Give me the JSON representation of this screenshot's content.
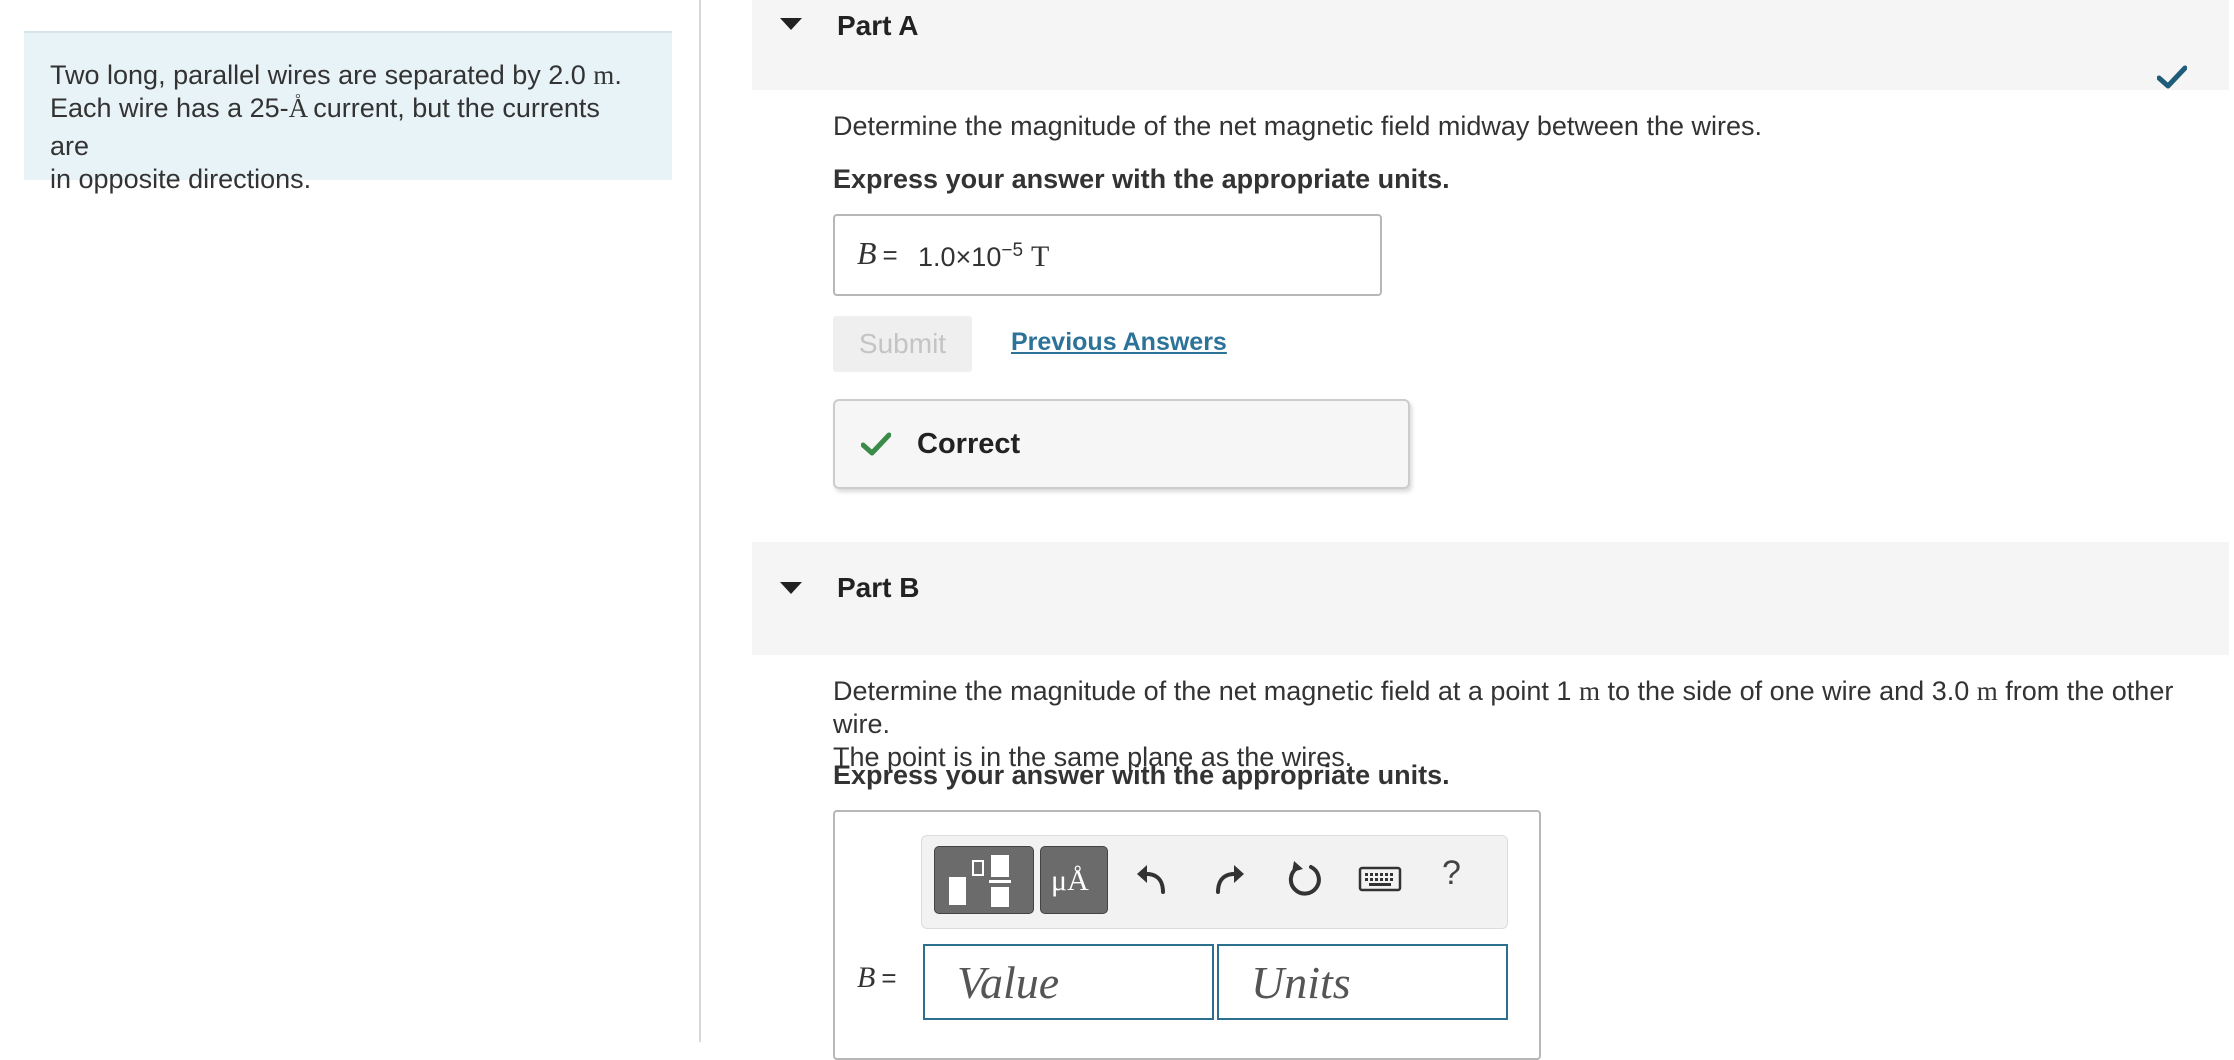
{
  "problem": {
    "line1_pre": "Two long, parallel wires are separated by 2.0 ",
    "line1_unit": "m",
    "line1_post": ".",
    "line2_pre": "Each wire has a 25-",
    "line2_unit": "A",
    "line2_post": " current, but the currents are",
    "line3": "in opposite directions."
  },
  "part_a": {
    "title": "Part A",
    "question": "Determine the magnitude of the net magnetic field midway between the wires.",
    "instruction": "Express your answer with the appropriate units.",
    "answer_label": "B",
    "answer_eq": "=",
    "answer_value_mantissa": "1.0×10",
    "answer_value_exponent": "−5",
    "answer_unit": "T",
    "submit_label": "Submit",
    "previous_answers_label": "Previous Answers",
    "feedback": "Correct",
    "status": "complete"
  },
  "part_b": {
    "title": "Part B",
    "question_pre": "Determine the magnitude of the net magnetic field at a point 1 ",
    "question_unit1": "m",
    "question_mid": " to the side of one wire and 3.0 ",
    "question_unit2": "m",
    "question_post": " from the other wire.",
    "question_line2": "The point is in the same plane as the wires.",
    "instruction": "Express your answer with the appropriate units.",
    "answer_label": "B",
    "answer_eq": "=",
    "units_button_label": "μÅ",
    "help_label": "?",
    "value_placeholder": "Value",
    "units_placeholder": "Units"
  },
  "colors": {
    "problem_bg": "#e7f3f7",
    "link": "#2d7399",
    "correct_green": "#3a8a4a",
    "header_check": "#1e5c7a",
    "input_border": "#2d6f8e"
  }
}
